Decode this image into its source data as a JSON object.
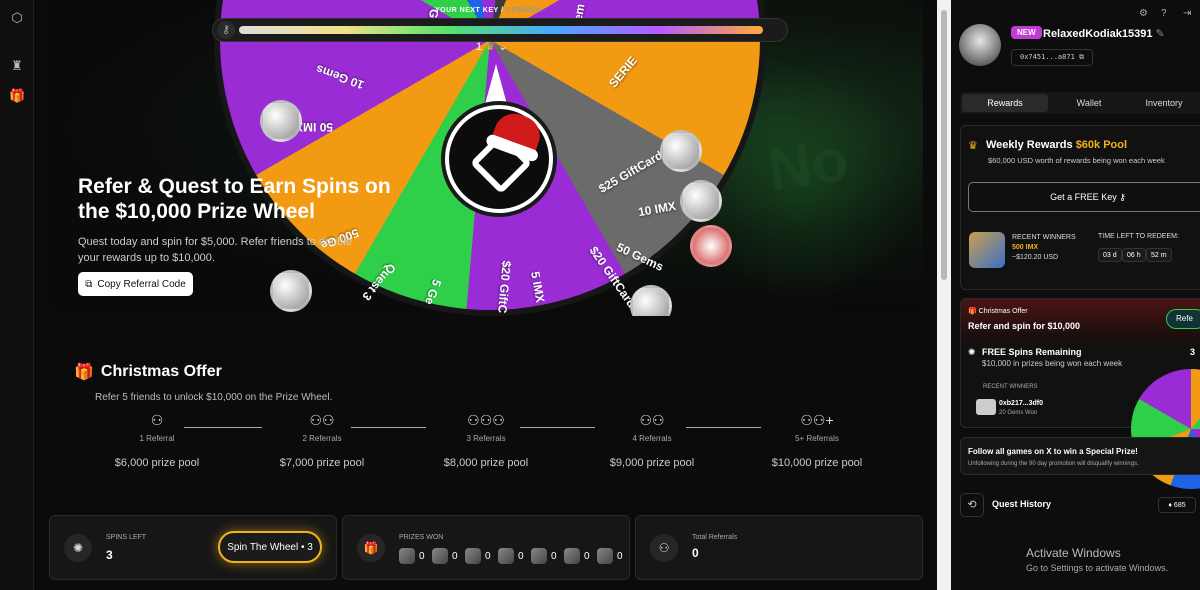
{
  "leftnav": {
    "icons": [
      "logo-icon",
      "trophy-icon",
      "gift-icon"
    ]
  },
  "hero": {
    "progress_label": "YOUR NEXT KEY / ",
    "progress_sub": "COMMON",
    "progress_fraction": 0.97,
    "level": "1",
    "title": "Refer & Quest to Earn Spins on the $10,000 Prize Wheel",
    "description": "Quest today and spin for $5,000. Refer friends to double your rewards up to $10,000.",
    "copy_button": "Copy Referral Code",
    "wheel_segments": [
      "$25 GiftCard",
      "10 IMX",
      "50 Gems",
      "$20 GiftCard",
      "5 IMX",
      "$20 GiftC",
      "5 Ge",
      "Quest 3",
      "500 Ge",
      "50 IMX",
      "10 Gems",
      "SERIE",
      "Gem",
      "Ge"
    ]
  },
  "christmas": {
    "title": "Christmas Offer",
    "subtitle": "Refer 5 friends to unlock $10,000 on the Prize Wheel.",
    "steps": [
      {
        "label": "1 Referral",
        "pool": "$6,000 prize pool"
      },
      {
        "label": "2 Referrals",
        "pool": "$7,000 prize pool"
      },
      {
        "label": "3 Referrals",
        "pool": "$8,000 prize pool"
      },
      {
        "label": "4 Referrals",
        "pool": "$9,000 prize pool"
      },
      {
        "label": "5+ Referrals",
        "pool": "$10,000 prize pool"
      }
    ]
  },
  "stats": {
    "spins_label": "SPINS LEFT",
    "spins_value": "3",
    "spin_button": "Spin The Wheel • 3",
    "prizes_label": "PRIZES WON",
    "prize_counts": [
      "0",
      "0",
      "0",
      "0",
      "0",
      "0",
      "0"
    ],
    "referrals_label": "Total Referrals",
    "referrals_value": "0"
  },
  "side": {
    "badge": "NEW",
    "username": "RelaxedKodiak15391",
    "address": "0x7451...a871",
    "tabs": [
      "Rewards",
      "Wallet",
      "Inventory"
    ],
    "weekly_title": "Weekly Rewards ",
    "weekly_pool": "$60k Pool",
    "weekly_sub": "$60,000 USD worth of rewards being won each week",
    "free_key": "Get a FREE Key",
    "recent_winners": "RECENT WINNERS",
    "winner_amount": "500 IMX",
    "winner_usd": "~$120.20 USD",
    "time_left": "TIME LEFT TO REDEEM:",
    "timer": [
      "03 d",
      "06 h",
      "52 m"
    ],
    "xo_label": "Christmas Offer",
    "xo_title": "Refer and spin for $10,000",
    "xo_btn": "Refe",
    "free_spins": "FREE Spins Remaining",
    "free_spins_sub": "$10,000 in prizes being won each week",
    "free_spins_count": "3",
    "xo_recent": "RECENT WINNERS",
    "xo_winner": "0xb217...3df0",
    "xo_won": "20 Gems Won",
    "follow_title": "Follow all games on X to win a Special Prize!",
    "follow_sub": "Unfollowing during the 90 day promotion will disqualify winnings.",
    "quest_history": "Quest History",
    "gems": "685"
  },
  "os": {
    "activate": "Activate Windows",
    "activate_sub": "Go to Settings to activate Windows."
  }
}
